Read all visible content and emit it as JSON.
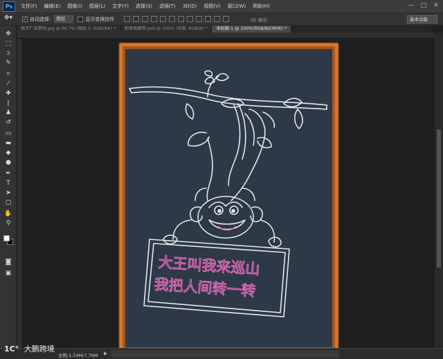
{
  "app": {
    "logo": "Ps"
  },
  "menus": [
    "文件(F)",
    "编辑(E)",
    "图像(I)",
    "图层(L)",
    "文字(Y)",
    "选择(S)",
    "滤镜(T)",
    "3D(D)",
    "视图(V)",
    "窗口(W)",
    "帮助(H)"
  ],
  "window_controls": [
    "—",
    "□",
    "✕"
  ],
  "options": {
    "auto_select_label": "自动选择:",
    "auto_select_value": "图层",
    "show_transform_label": "显示变换控件",
    "mode_3d_label": "3D 模式:",
    "workspace": "基本功能"
  },
  "tabs": [
    {
      "label": "猴子广告素材.jpg @ 66.7% (图层 0, RGB/8#) *",
      "active": false
    },
    {
      "label": "粉笔画教程.psd @ 100% (背景, RGB/8) *",
      "active": false
    },
    {
      "label": "未标题-1 @ 100%(RGB/8/CMYK) *",
      "active": true
    }
  ],
  "tools": [
    {
      "name": "move-tool-icon",
      "glyph": "✥"
    },
    {
      "name": "marquee-tool-icon",
      "glyph": "⬚"
    },
    {
      "name": "lasso-tool-icon",
      "glyph": "ↄ"
    },
    {
      "name": "quick-select-tool-icon",
      "glyph": "✎"
    },
    {
      "name": "crop-tool-icon",
      "glyph": "⌗"
    },
    {
      "name": "eyedropper-tool-icon",
      "glyph": "⁄"
    },
    {
      "name": "healing-brush-tool-icon",
      "glyph": "✚"
    },
    {
      "name": "brush-tool-icon",
      "glyph": "ǀ"
    },
    {
      "name": "clone-stamp-tool-icon",
      "glyph": "♟"
    },
    {
      "name": "history-brush-tool-icon",
      "glyph": "↺"
    },
    {
      "name": "eraser-tool-icon",
      "glyph": "▭"
    },
    {
      "name": "gradient-tool-icon",
      "glyph": "▬"
    },
    {
      "name": "blur-tool-icon",
      "glyph": "◆"
    },
    {
      "name": "dodge-tool-icon",
      "glyph": "●"
    },
    {
      "name": "pen-tool-icon",
      "glyph": "✒"
    },
    {
      "name": "type-tool-icon",
      "glyph": "T"
    },
    {
      "name": "path-select-tool-icon",
      "glyph": "➤"
    },
    {
      "name": "shape-tool-icon",
      "glyph": "▢"
    },
    {
      "name": "hand-tool-icon",
      "glyph": "✋"
    },
    {
      "name": "zoom-tool-icon",
      "glyph": "⚲"
    }
  ],
  "canvas": {
    "sign_line1": "大王叫我来巡山",
    "sign_line2": "我把人间转一转"
  },
  "status": {
    "doc_info": "文档:1.54M/7.76M",
    "arrow": "▶"
  },
  "watermark": {
    "logo": "1C°",
    "text": "大鹏跨境"
  },
  "colors": {
    "frame": "#d6782c",
    "board": "#2d3946",
    "chalk": "#e6e9ee",
    "pink_text": "#ee6fc4"
  }
}
